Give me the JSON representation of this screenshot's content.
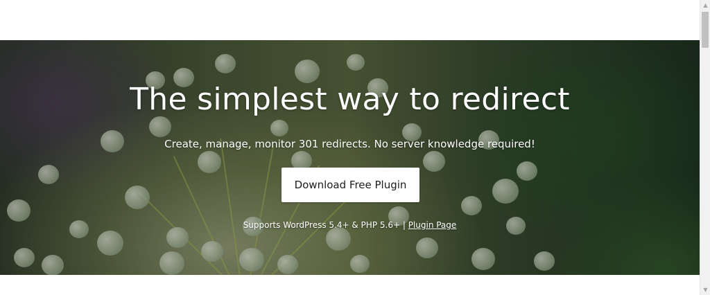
{
  "hero": {
    "title": "The simplest way to redirect",
    "subtitle": "Create, manage, monitor 301 redirects. No server knowledge required!",
    "cta_label": "Download Free Plugin",
    "support_text": "Supports WordPress 5.4+ & PHP 5.6+ | ",
    "plugin_link_label": "Plugin Page"
  },
  "scrollbar": {
    "up_icon": "▲",
    "down_icon": "▼"
  }
}
